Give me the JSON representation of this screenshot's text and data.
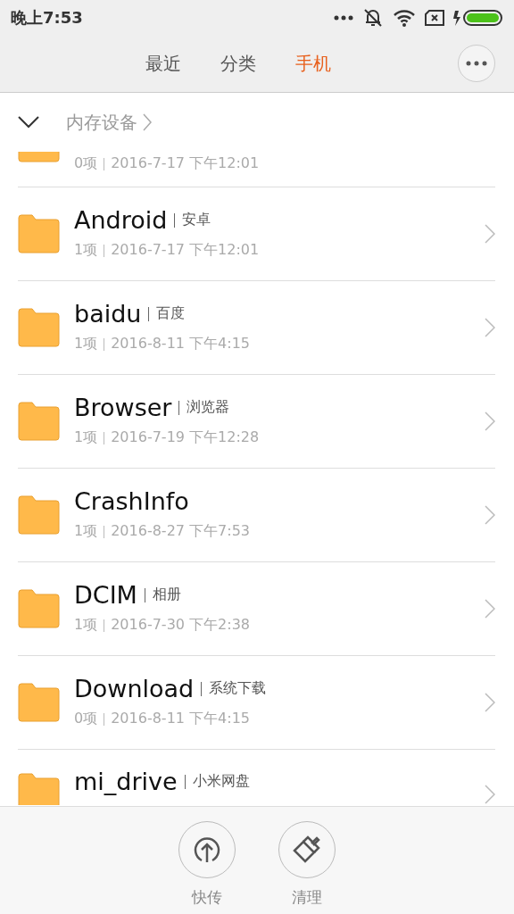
{
  "status_bar": {
    "time": "晚上7:53"
  },
  "tabs": [
    {
      "label": "最近",
      "selected": false
    },
    {
      "label": "分类",
      "selected": false
    },
    {
      "label": "手机",
      "selected": true
    }
  ],
  "breadcrumb": {
    "expanded": true,
    "label": "内存设备"
  },
  "files": [
    {
      "meta_count": "0项",
      "meta_date": "2016-7-17 下午12:01"
    },
    {
      "name": "Android",
      "tag": "安卓",
      "meta_count": "1项",
      "meta_date": "2016-7-17 下午12:01"
    },
    {
      "name": "baidu",
      "tag": "百度",
      "meta_count": "1项",
      "meta_date": "2016-8-11 下午4:15"
    },
    {
      "name": "Browser",
      "tag": "浏览器",
      "meta_count": "1项",
      "meta_date": "2016-7-19 下午12:28"
    },
    {
      "name": "CrashInfo",
      "meta_count": "1项",
      "meta_date": "2016-8-27 下午7:53"
    },
    {
      "name": "DCIM",
      "tag": "相册",
      "meta_count": "1项",
      "meta_date": "2016-7-30 下午2:38"
    },
    {
      "name": "Download",
      "tag": "系统下载",
      "meta_count": "0项",
      "meta_date": "2016-8-11 下午4:15"
    },
    {
      "name": "mi_drive",
      "tag": "小米网盘"
    }
  ],
  "actions": [
    {
      "kind": "share",
      "label": "快传"
    },
    {
      "kind": "clean",
      "label": "清理"
    }
  ]
}
